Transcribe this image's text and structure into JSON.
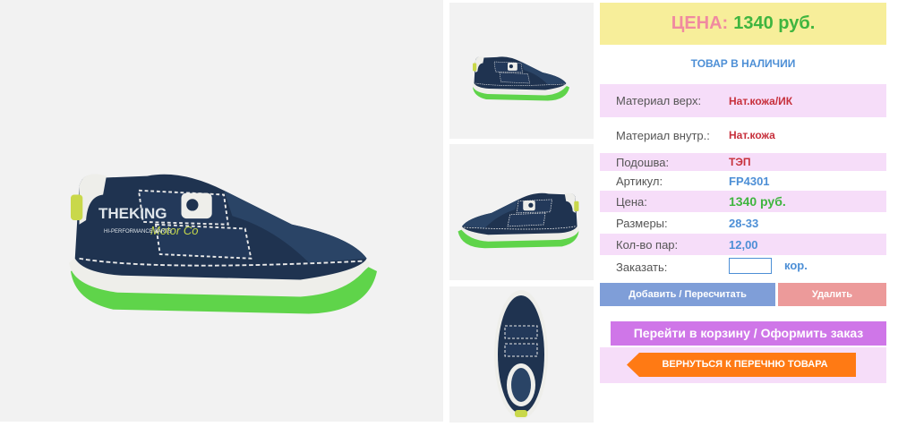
{
  "colors": {
    "price_bg": "#f7ee9a",
    "price_label": "#f08aa0",
    "price_value": "#3fb53f",
    "link_blue": "#4d8fd6",
    "highlight_row": "#f6ddf9",
    "add_button": "#7f9ed8",
    "delete_button": "#ec9a9a",
    "cart_button": "#cf76e8",
    "back_button": "#ff7a14"
  },
  "images": {
    "main": "shoe-side-view",
    "thumbnails": [
      "shoe-angle-view",
      "shoe-inner-side-view",
      "shoe-top-view"
    ]
  },
  "price": {
    "label": "ЦЕНА:",
    "value": "1340 руб."
  },
  "stock_status": "ТОВАР В НАЛИЧИИ",
  "specs": [
    {
      "label": "Материал верх:",
      "value": "Нат.кожа/ИК"
    },
    {
      "label": "Материал внутр.:",
      "value": "Нат.кожа"
    },
    {
      "label": "Подошва:",
      "value": "ТЭП"
    },
    {
      "label": "Артикул:",
      "value": "FP4301"
    },
    {
      "label": "Цена:",
      "value": "1340 руб."
    },
    {
      "label": "Размеры:",
      "value": "28-33"
    },
    {
      "label": "Кол-во пар:",
      "value": "12,00"
    }
  ],
  "order": {
    "label": "Заказать:",
    "value": "",
    "unit": "кор."
  },
  "buttons": {
    "add": "Добавить / Пересчитать",
    "delete": "Удалить",
    "cart": "Перейти в корзину / Оформить заказ",
    "back": "ВЕРНУТЬСЯ К ПЕРЕЧНЮ ТОВАРА"
  },
  "brand_print": {
    "line1": "THEKING",
    "line2": "Motor Co",
    "line3": "HI-PERFORMANCE PARTS"
  }
}
